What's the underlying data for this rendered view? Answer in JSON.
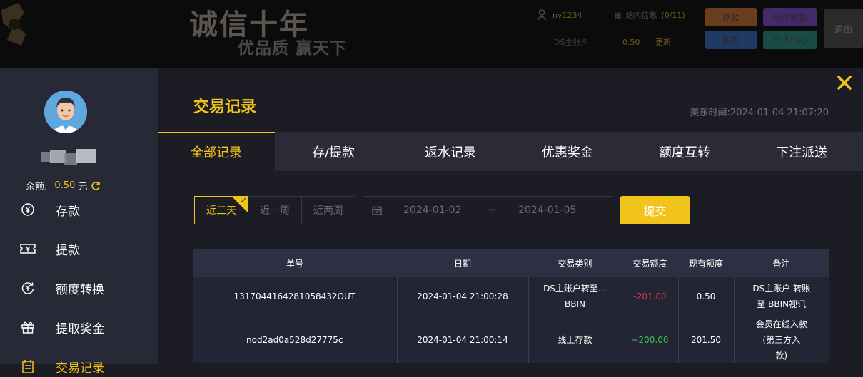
{
  "site_header": {
    "slogan_main": "诚信十年",
    "slogan_sub": "优品质 赢天下",
    "username": "ny1234",
    "messages_label": "站内信息",
    "messages_count": "(0/11)",
    "main_account_label": "DS主账户",
    "main_account_value": "0.50",
    "refresh_label": "更新",
    "buttons": {
      "deposit": "存款",
      "transfer": "额度转换",
      "withdraw": "取款",
      "center": "个人中心",
      "logout": "退出"
    }
  },
  "sidebar": {
    "balance_label": "余额:",
    "balance_value": "0.50",
    "balance_unit": "元",
    "items": [
      {
        "label": "存款",
        "icon": "yen-circle-icon"
      },
      {
        "label": "提款",
        "icon": "ticket-icon"
      },
      {
        "label": "额度转换",
        "icon": "exchange-icon"
      },
      {
        "label": "提取奖金",
        "icon": "gift-icon"
      },
      {
        "label": "交易记录",
        "icon": "record-icon"
      }
    ]
  },
  "main": {
    "title": "交易记录",
    "est_time_label": "美东时间:",
    "est_time_value": "2024-01-04 21:07:20",
    "tabs": [
      "全部记录",
      "存/提款",
      "返水记录",
      "优惠奖金",
      "额度互转",
      "下注派送"
    ],
    "active_tab": 0,
    "ranges": [
      "近三天",
      "近一周",
      "近两周"
    ],
    "active_range": 0,
    "date_from": "2024-01-02",
    "date_separator": "~",
    "date_to": "2024-01-05",
    "submit_label": "提交"
  },
  "table": {
    "headers": [
      "单号",
      "日期",
      "交易类别",
      "交易额度",
      "现有额度",
      "备注"
    ],
    "rows": [
      {
        "id": "1317044164281058432OUT",
        "date": "2024-01-04 21:00:28",
        "type_line1": "DS主账户转至…",
        "type_line2": "BBIN",
        "amount": "-201.00",
        "balance": "0.50",
        "remark_line1": "DS主账户 转账",
        "remark_line2": "至 BBIN视讯",
        "remark_line3": ""
      },
      {
        "id": "nod2ad0a528d27775c",
        "date": "2024-01-04 21:00:14",
        "type_line1": "线上存款",
        "type_line2": "",
        "amount": "+200.00",
        "balance": "201.50",
        "remark_line1": "会员在线入款",
        "remark_line2": "(第三方入",
        "remark_line3": "款)"
      }
    ]
  },
  "colors": {
    "accent": "#f2c318",
    "negative": "#e0344a",
    "positive": "#37c451"
  }
}
